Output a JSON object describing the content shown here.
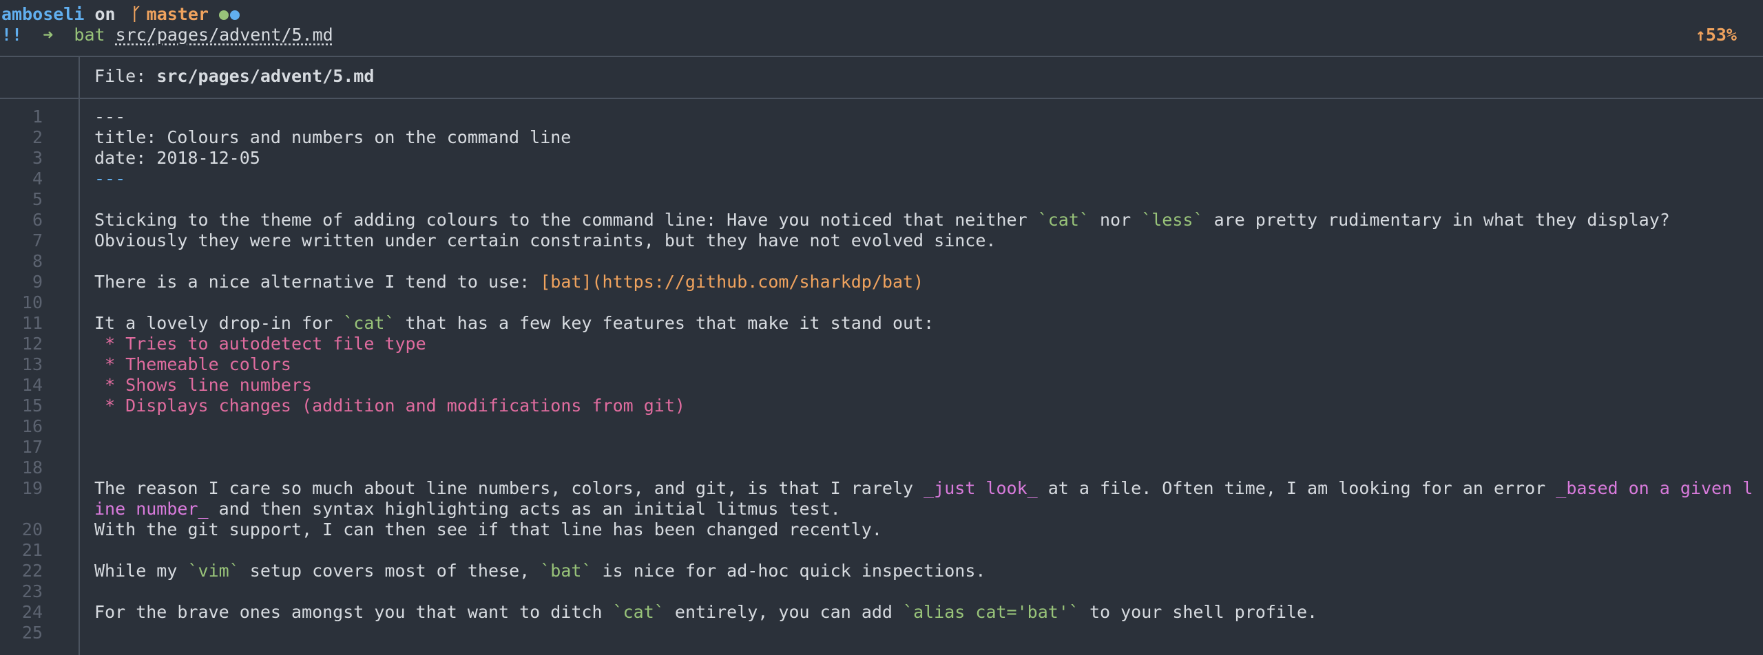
{
  "prompt": {
    "host": "amboseli",
    "on": "on",
    "branch_icon": "git-branch-icon",
    "branch": "master",
    "status_colors": [
      "#98c379",
      "#61afef"
    ],
    "bang": "!!",
    "arrow": "➜",
    "command": "bat",
    "path": "src/pages/advent/5.md",
    "battery": "↑53%"
  },
  "file": {
    "label": "File:",
    "name": "src/pages/advent/5.md"
  },
  "lines": [
    {
      "num": "1",
      "parts": [
        {
          "t": "---",
          "c": ""
        }
      ]
    },
    {
      "num": "2",
      "parts": [
        {
          "t": "title: Colours and numbers on the command line",
          "c": ""
        }
      ]
    },
    {
      "num": "3",
      "parts": [
        {
          "t": "date: 2018-12-05",
          "c": ""
        }
      ]
    },
    {
      "num": "4",
      "parts": [
        {
          "t": "---",
          "c": "dash"
        }
      ]
    },
    {
      "num": "5",
      "parts": []
    },
    {
      "num": "6",
      "parts": [
        {
          "t": "Sticking to the theme of adding colours to the command line: Have you noticed that neither ",
          "c": ""
        },
        {
          "t": "`cat`",
          "c": "code"
        },
        {
          "t": " nor ",
          "c": ""
        },
        {
          "t": "`less`",
          "c": "code"
        },
        {
          "t": " are pretty rudimentary in what they display?",
          "c": ""
        }
      ]
    },
    {
      "num": "7",
      "parts": [
        {
          "t": "Obviously they were written under certain constraints, but they have not evolved since.",
          "c": ""
        }
      ]
    },
    {
      "num": "8",
      "parts": []
    },
    {
      "num": "9",
      "parts": [
        {
          "t": "There is a nice alternative I tend to use: ",
          "c": ""
        },
        {
          "t": "[bat](https://github.com/sharkdp/bat)",
          "c": "link"
        }
      ]
    },
    {
      "num": "10",
      "parts": []
    },
    {
      "num": "11",
      "parts": [
        {
          "t": "It a lovely drop-in for ",
          "c": ""
        },
        {
          "t": "`cat`",
          "c": "code"
        },
        {
          "t": " that has a few key features that make it stand out:",
          "c": ""
        }
      ]
    },
    {
      "num": "12",
      "parts": [
        {
          "t": " * Tries to autodetect file type",
          "c": "list"
        }
      ]
    },
    {
      "num": "13",
      "parts": [
        {
          "t": " * Themeable colors",
          "c": "list"
        }
      ]
    },
    {
      "num": "14",
      "parts": [
        {
          "t": " * Shows line numbers",
          "c": "list"
        }
      ]
    },
    {
      "num": "15",
      "parts": [
        {
          "t": " * Displays changes (addition and modifications from git)",
          "c": "list"
        }
      ]
    },
    {
      "num": "16",
      "parts": []
    },
    {
      "num": "17",
      "parts": []
    },
    {
      "num": "18",
      "parts": []
    },
    {
      "num": "19",
      "wrap": true,
      "parts": [
        {
          "t": "The reason I care so much about line numbers, colors, and git, is that I rarely ",
          "c": ""
        },
        {
          "t": "_just look_",
          "c": "emph"
        },
        {
          "t": " at a file. Often time, I am looking for an error ",
          "c": ""
        },
        {
          "t": "_based on a given line number_",
          "c": "emph"
        },
        {
          "t": " and then syntax highlighting acts as an initial litmus test.",
          "c": ""
        }
      ]
    },
    {
      "num": "20",
      "parts": [
        {
          "t": "With the git support, I can then see if that line has been changed recently.",
          "c": ""
        }
      ]
    },
    {
      "num": "21",
      "parts": []
    },
    {
      "num": "22",
      "parts": [
        {
          "t": "While my ",
          "c": ""
        },
        {
          "t": "`vim`",
          "c": "code"
        },
        {
          "t": " setup covers most of these, ",
          "c": ""
        },
        {
          "t": "`bat`",
          "c": "code"
        },
        {
          "t": " is nice for ad-hoc quick inspections.",
          "c": ""
        }
      ]
    },
    {
      "num": "23",
      "parts": []
    },
    {
      "num": "24",
      "parts": [
        {
          "t": "For the brave ones amongst you that want to ditch ",
          "c": ""
        },
        {
          "t": "`cat`",
          "c": "code"
        },
        {
          "t": " entirely, you can add ",
          "c": ""
        },
        {
          "t": "`alias cat='bat'`",
          "c": "code"
        },
        {
          "t": " to your shell profile.",
          "c": ""
        }
      ]
    },
    {
      "num": "25",
      "parts": []
    }
  ]
}
